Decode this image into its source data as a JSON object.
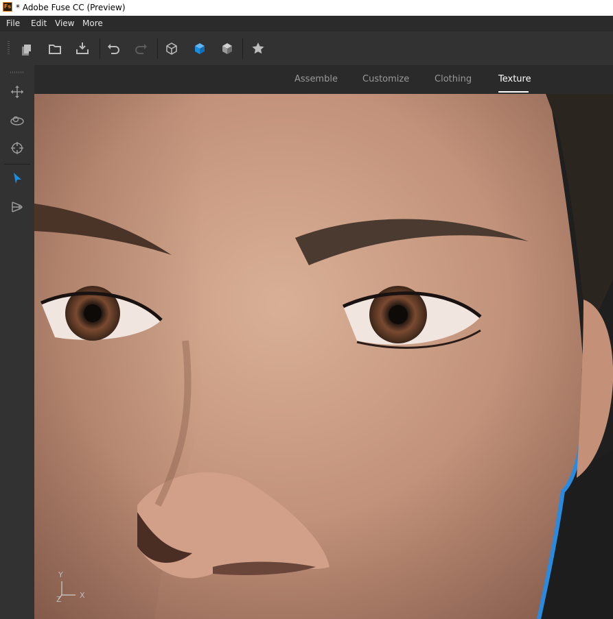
{
  "window": {
    "title": "* Adobe Fuse CC (Preview)",
    "logo_text": "Fs"
  },
  "menu": {
    "file": "File",
    "edit": "Edit",
    "view": "View",
    "more": "More"
  },
  "toolbar": {
    "buttons": [
      {
        "name": "new-icon"
      },
      {
        "name": "open-folder-icon"
      },
      {
        "name": "save-download-icon"
      },
      {
        "name": "undo-icon"
      },
      {
        "name": "redo-icon",
        "disabled": true
      },
      {
        "name": "cube-wireframe-icon"
      },
      {
        "name": "cube-solid-icon",
        "active": true,
        "color": "#1a8ce2"
      },
      {
        "name": "cube-shaded-icon"
      },
      {
        "name": "star-icon"
      }
    ]
  },
  "sidebar": {
    "tools": [
      {
        "name": "move-arrows-icon"
      },
      {
        "name": "orbit-icon"
      },
      {
        "name": "target-icon"
      },
      {
        "name": "select-arrow-icon",
        "active": true,
        "color": "#1a8ce2"
      },
      {
        "name": "perspective-icon"
      }
    ]
  },
  "tabs": {
    "assemble": "Assemble",
    "customize": "Customize",
    "clothing": "Clothing",
    "texture": "Texture",
    "active": "Texture"
  },
  "viewport": {
    "axis_y": "Y",
    "axis_x": "X",
    "axis_z": "Z",
    "content": "3d-face-closeup"
  },
  "colors": {
    "accent": "#1a8ce2",
    "app_logo": "#e98b1f",
    "ui_dark": "#323232"
  }
}
